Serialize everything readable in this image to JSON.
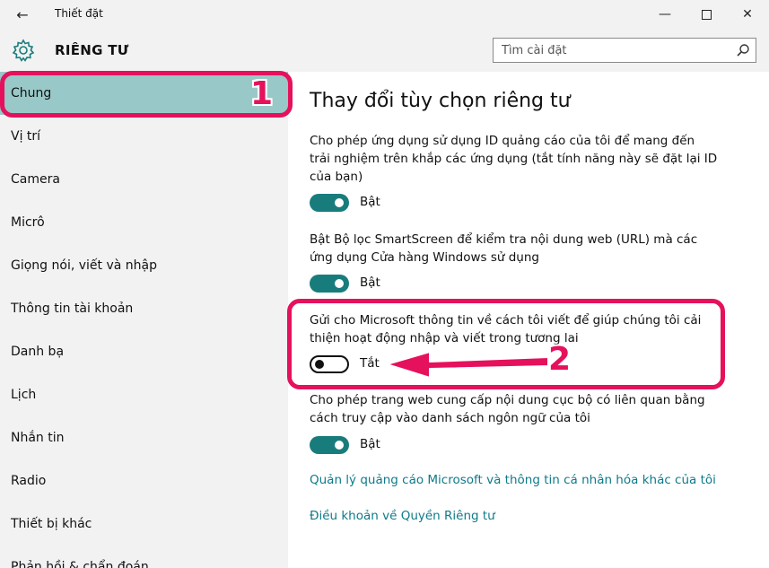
{
  "window": {
    "title": "Thiết đặt",
    "back_icon": "back-arrow-icon",
    "minimize_icon": "minimize-icon",
    "maximize_icon": "maximize-icon",
    "close_icon": "close-icon"
  },
  "header": {
    "icon": "gear-icon",
    "title": "RIÊNG TƯ",
    "search_placeholder": "Tìm cài đặt",
    "search_icon": "search-icon"
  },
  "sidebar": {
    "items": [
      {
        "label": "Chung",
        "selected": true
      },
      {
        "label": "Vị trí"
      },
      {
        "label": "Camera"
      },
      {
        "label": "Micrô"
      },
      {
        "label": "Giọng nói, viết và nhập"
      },
      {
        "label": "Thông tin tài khoản"
      },
      {
        "label": "Danh bạ"
      },
      {
        "label": "Lịch"
      },
      {
        "label": "Nhắn tin"
      },
      {
        "label": "Radio"
      },
      {
        "label": "Thiết bị khác"
      },
      {
        "label": "Phản hồi & chẩn đoán"
      }
    ]
  },
  "main": {
    "title": "Thay đổi tùy chọn riêng tư",
    "settings": [
      {
        "line1": "Cho phép ứng dụng sử dụng ID quảng cáo của tôi để mang đến",
        "line2": "trải nghiệm trên khắp các ứng dụng (tắt tính năng này sẽ đặt lại ID",
        "line3": "của bạn)",
        "state": "Bật",
        "on": true
      },
      {
        "line1": "Bật Bộ lọc SmartScreen để kiểm tra nội dung web (URL) mà các",
        "line2": "ứng dụng Cửa hàng Windows sử dụng",
        "state": "Bật",
        "on": true
      },
      {
        "line1": "Gửi cho Microsoft thông tin về cách tôi viết để giúp chúng tôi cải",
        "line2": "thiện hoạt động nhập và viết trong tương lai",
        "state": "Tắt",
        "on": false
      },
      {
        "line1": "Cho phép trang web cung cấp nội dung cục bộ có liên quan bằng",
        "line2": "cách truy cập vào danh sách ngôn ngữ của tôi",
        "state": "Bật",
        "on": true
      }
    ],
    "links": [
      "Quản lý quảng cáo Microsoft và thông tin cá nhân hóa khác của tôi",
      "Điều khoản về Quyền Riêng tư"
    ]
  },
  "annotations": {
    "step1": "1",
    "step2": "2",
    "color": "#e5115c"
  },
  "colors": {
    "accent": "#197c7c",
    "selected_bg": "#99c8c8",
    "link": "#0f7a8a",
    "chrome_bg": "#f2f2f2"
  }
}
